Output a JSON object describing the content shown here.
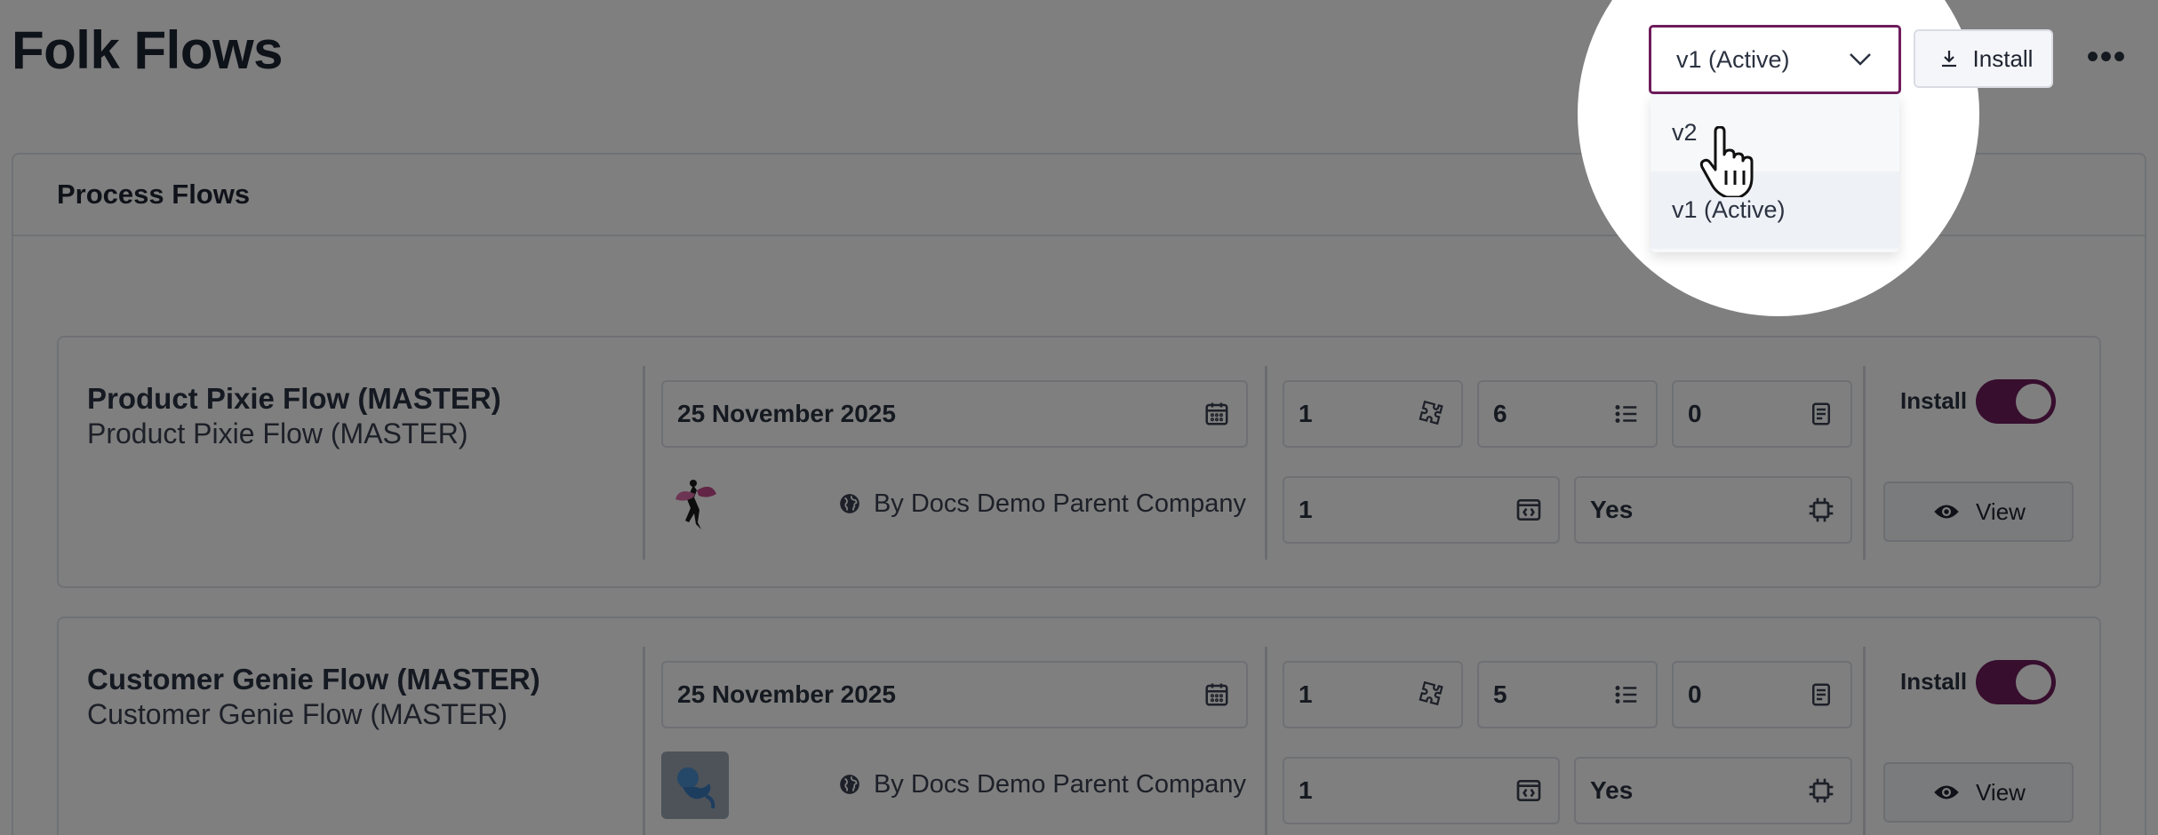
{
  "header": {
    "title": "Folk Flows",
    "version_selected": "v1 (Active)",
    "install_label": "Install",
    "more_label": "•••"
  },
  "version_dropdown": {
    "options": [
      "v2",
      "v1 (Active)"
    ],
    "hovered": "v2"
  },
  "panel": {
    "title": "Process Flows"
  },
  "flows": [
    {
      "name": "Product Pixie Flow (MASTER)",
      "subtitle": "Product Pixie Flow (MASTER)",
      "date": "25 November 2025",
      "byline": "By Docs Demo Parent Company",
      "stats": {
        "modules": "1",
        "steps": "6",
        "docs": "0",
        "code": "1",
        "compiled": "Yes"
      },
      "install_label": "Install",
      "install_on": true,
      "view_label": "View"
    },
    {
      "name": "Customer Genie Flow (MASTER)",
      "subtitle": "Customer Genie Flow (MASTER)",
      "date": "25 November 2025",
      "byline": "By Docs Demo Parent Company",
      "stats": {
        "modules": "1",
        "steps": "5",
        "docs": "0",
        "code": "1",
        "compiled": "Yes"
      },
      "install_label": "Install",
      "install_on": true,
      "view_label": "View"
    }
  ],
  "colors": {
    "accent": "#6e1d5c",
    "overlay": "rgba(0,0,0,0.5)"
  },
  "icons": [
    "chevron-down-icon",
    "download-icon",
    "calendar-icon",
    "puzzle-icon",
    "list-icon",
    "document-icon",
    "code-window-icon",
    "chip-icon",
    "globe-icon",
    "eye-icon",
    "hand-cursor-icon"
  ]
}
